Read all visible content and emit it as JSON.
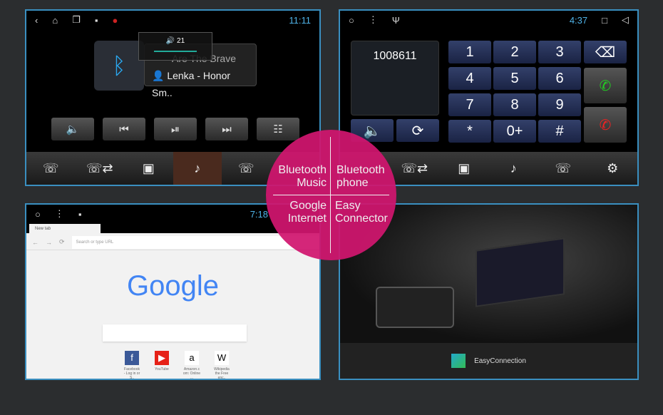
{
  "music": {
    "time": "11:11",
    "volume": "21",
    "song": "Are The Brave",
    "artist": "Lenka - Honor Sm.."
  },
  "phone": {
    "time": "4:37",
    "number": "1008611",
    "keys": [
      "1",
      "2",
      "3",
      "4",
      "5",
      "6",
      "7",
      "8",
      "9",
      "*",
      "0+",
      "#"
    ]
  },
  "browser": {
    "time": "7:18",
    "tab": "New tab",
    "placeholder": "Search or type URL",
    "logo": "Google",
    "shortcuts": [
      {
        "name": "Facebook",
        "sub": "- Log in or S.."
      },
      {
        "name": "YouTube",
        "sub": ""
      },
      {
        "name": "Amazon.c",
        "sub": "om: Online ..."
      },
      {
        "name": "Wikipedia",
        "sub": "the Free enc.."
      }
    ]
  },
  "easy": {
    "label": "EasyConnection"
  },
  "features": {
    "bt_music": "Bluetooth Music",
    "bt_phone": "Bluetooth phone",
    "google": "Google Internet",
    "easy": "Easy Connector"
  },
  "colors": {
    "accent": "#3a8fc0",
    "pink": "#d1166f",
    "time": "#4fb3e8"
  }
}
